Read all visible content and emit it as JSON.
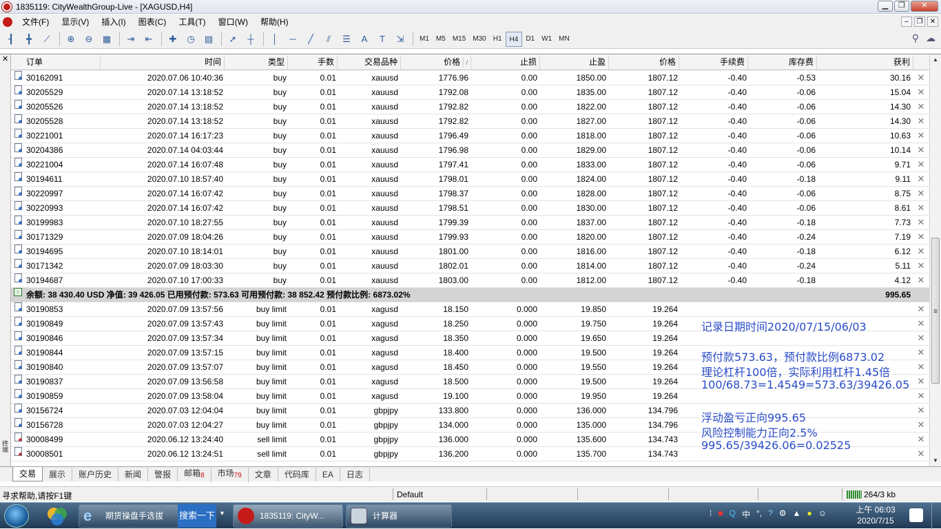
{
  "window": {
    "title": "1835119: CityWealthGroup-Live - [XAGUSD,H4]"
  },
  "menu": [
    "文件(F)",
    "显示(V)",
    "插入(I)",
    "图表(C)",
    "工具(T)",
    "窗口(W)",
    "帮助(H)"
  ],
  "toolbar": {
    "timeframes": [
      "M1",
      "M5",
      "M15",
      "M30",
      "H1",
      "H4",
      "D1",
      "W1",
      "MN"
    ],
    "active_timeframe": "H4"
  },
  "table": {
    "columns": {
      "order": "订单",
      "time": "时间",
      "type": "类型",
      "lots": "手数",
      "symbol": "交易品种",
      "price": "价格",
      "sl": "止损",
      "tp": "止盈",
      "current": "价格",
      "commission": "手续费",
      "swap": "库存费",
      "profit": "获利"
    },
    "positions": [
      {
        "order": "30162091",
        "time": "2020.07.06 10:40:36",
        "type": "buy",
        "lots": "0.01",
        "symbol": "xauusd",
        "price": "1776.96",
        "sl": "0.00",
        "tp": "1850.00",
        "current": "1807.12",
        "commission": "-0.40",
        "swap": "-0.53",
        "profit": "30.16"
      },
      {
        "order": "30205529",
        "time": "2020.07.14 13:18:52",
        "type": "buy",
        "lots": "0.01",
        "symbol": "xauusd",
        "price": "1792.08",
        "sl": "0.00",
        "tp": "1835.00",
        "current": "1807.12",
        "commission": "-0.40",
        "swap": "-0.06",
        "profit": "15.04"
      },
      {
        "order": "30205526",
        "time": "2020.07.14 13:18:52",
        "type": "buy",
        "lots": "0.01",
        "symbol": "xauusd",
        "price": "1792.82",
        "sl": "0.00",
        "tp": "1822.00",
        "current": "1807.12",
        "commission": "-0.40",
        "swap": "-0.06",
        "profit": "14.30"
      },
      {
        "order": "30205528",
        "time": "2020.07.14 13:18:52",
        "type": "buy",
        "lots": "0.01",
        "symbol": "xauusd",
        "price": "1792.82",
        "sl": "0.00",
        "tp": "1827.00",
        "current": "1807.12",
        "commission": "-0.40",
        "swap": "-0.06",
        "profit": "14.30"
      },
      {
        "order": "30221001",
        "time": "2020.07.14 16:17:23",
        "type": "buy",
        "lots": "0.01",
        "symbol": "xauusd",
        "price": "1796.49",
        "sl": "0.00",
        "tp": "1818.00",
        "current": "1807.12",
        "commission": "-0.40",
        "swap": "-0.06",
        "profit": "10.63"
      },
      {
        "order": "30204386",
        "time": "2020.07.14 04:03:44",
        "type": "buy",
        "lots": "0.01",
        "symbol": "xauusd",
        "price": "1796.98",
        "sl": "0.00",
        "tp": "1829.00",
        "current": "1807.12",
        "commission": "-0.40",
        "swap": "-0.06",
        "profit": "10.14"
      },
      {
        "order": "30221004",
        "time": "2020.07.14 16:07:48",
        "type": "buy",
        "lots": "0.01",
        "symbol": "xauusd",
        "price": "1797.41",
        "sl": "0.00",
        "tp": "1833.00",
        "current": "1807.12",
        "commission": "-0.40",
        "swap": "-0.06",
        "profit": "9.71"
      },
      {
        "order": "30194611",
        "time": "2020.07.10 18:57:40",
        "type": "buy",
        "lots": "0.01",
        "symbol": "xauusd",
        "price": "1798.01",
        "sl": "0.00",
        "tp": "1824.00",
        "current": "1807.12",
        "commission": "-0.40",
        "swap": "-0.18",
        "profit": "9.11"
      },
      {
        "order": "30220997",
        "time": "2020.07.14 16:07:42",
        "type": "buy",
        "lots": "0.01",
        "symbol": "xauusd",
        "price": "1798.37",
        "sl": "0.00",
        "tp": "1828.00",
        "current": "1807.12",
        "commission": "-0.40",
        "swap": "-0.06",
        "profit": "8.75"
      },
      {
        "order": "30220993",
        "time": "2020.07.14 16:07:42",
        "type": "buy",
        "lots": "0.01",
        "symbol": "xauusd",
        "price": "1798.51",
        "sl": "0.00",
        "tp": "1830.00",
        "current": "1807.12",
        "commission": "-0.40",
        "swap": "-0.06",
        "profit": "8.61"
      },
      {
        "order": "30199983",
        "time": "2020.07.10 18:27:55",
        "type": "buy",
        "lots": "0.01",
        "symbol": "xauusd",
        "price": "1799.39",
        "sl": "0.00",
        "tp": "1837.00",
        "current": "1807.12",
        "commission": "-0.40",
        "swap": "-0.18",
        "profit": "7.73"
      },
      {
        "order": "30171329",
        "time": "2020.07.09 18:04:26",
        "type": "buy",
        "lots": "0.01",
        "symbol": "xauusd",
        "price": "1799.93",
        "sl": "0.00",
        "tp": "1820.00",
        "current": "1807.12",
        "commission": "-0.40",
        "swap": "-0.24",
        "profit": "7.19"
      },
      {
        "order": "30194695",
        "time": "2020.07.10 18:14:01",
        "type": "buy",
        "lots": "0.01",
        "symbol": "xauusd",
        "price": "1801.00",
        "sl": "0.00",
        "tp": "1816.00",
        "current": "1807.12",
        "commission": "-0.40",
        "swap": "-0.18",
        "profit": "6.12"
      },
      {
        "order": "30171342",
        "time": "2020.07.09 18:03:30",
        "type": "buy",
        "lots": "0.01",
        "symbol": "xauusd",
        "price": "1802.01",
        "sl": "0.00",
        "tp": "1814.00",
        "current": "1807.12",
        "commission": "-0.40",
        "swap": "-0.24",
        "profit": "5.11"
      },
      {
        "order": "30194687",
        "time": "2020.07.10 17:00:33",
        "type": "buy",
        "lots": "0.01",
        "symbol": "xauusd",
        "price": "1803.00",
        "sl": "0.00",
        "tp": "1812.00",
        "current": "1807.12",
        "commission": "-0.40",
        "swap": "-0.18",
        "profit": "4.12"
      }
    ],
    "summary": {
      "text": "余额: 38 430.40 USD  净值: 39 426.05  已用预付款: 573.63  可用预付款: 38 852.42  预付款比例: 6873.02%",
      "profit": "995.65"
    },
    "pending": [
      {
        "order": "30190853",
        "time": "2020.07.09 13:57:56",
        "type": "buy limit",
        "lots": "0.01",
        "symbol": "xagusd",
        "price": "18.150",
        "sl": "0.000",
        "tp": "19.850",
        "current": "19.264"
      },
      {
        "order": "30190849",
        "time": "2020.07.09 13:57:43",
        "type": "buy limit",
        "lots": "0.01",
        "symbol": "xagusd",
        "price": "18.250",
        "sl": "0.000",
        "tp": "19.750",
        "current": "19.264"
      },
      {
        "order": "30190846",
        "time": "2020.07.09 13:57:34",
        "type": "buy limit",
        "lots": "0.01",
        "symbol": "xagusd",
        "price": "18.350",
        "sl": "0.000",
        "tp": "19.650",
        "current": "19.264"
      },
      {
        "order": "30190844",
        "time": "2020.07.09 13:57:15",
        "type": "buy limit",
        "lots": "0.01",
        "symbol": "xagusd",
        "price": "18.400",
        "sl": "0.000",
        "tp": "19.500",
        "current": "19.264"
      },
      {
        "order": "30190840",
        "time": "2020.07.09 13:57:07",
        "type": "buy limit",
        "lots": "0.01",
        "symbol": "xagusd",
        "price": "18.450",
        "sl": "0.000",
        "tp": "19.550",
        "current": "19.264"
      },
      {
        "order": "30190837",
        "time": "2020.07.09 13:56:58",
        "type": "buy limit",
        "lots": "0.01",
        "symbol": "xagusd",
        "price": "18.500",
        "sl": "0.000",
        "tp": "19.500",
        "current": "19.264"
      },
      {
        "order": "30190859",
        "time": "2020.07.09 13:58:04",
        "type": "buy limit",
        "lots": "0.01",
        "symbol": "xagusd",
        "price": "19.100",
        "sl": "0.000",
        "tp": "19.950",
        "current": "19.264"
      },
      {
        "order": "30156724",
        "time": "2020.07.03 12:04:04",
        "type": "buy limit",
        "lots": "0.01",
        "symbol": "gbpjpy",
        "price": "133.800",
        "sl": "0.000",
        "tp": "136.000",
        "current": "134.796"
      },
      {
        "order": "30156728",
        "time": "2020.07.03 12:04:27",
        "type": "buy limit",
        "lots": "0.01",
        "symbol": "gbpjpy",
        "price": "134.000",
        "sl": "0.000",
        "tp": "135.000",
        "current": "134.796"
      },
      {
        "order": "30008499",
        "time": "2020.06.12 13:24:40",
        "type": "sell limit",
        "lots": "0.01",
        "symbol": "gbpjpy",
        "price": "136.000",
        "sl": "0.000",
        "tp": "135.600",
        "current": "134.743"
      },
      {
        "order": "30008501",
        "time": "2020.06.12 13:24:51",
        "type": "sell limit",
        "lots": "0.01",
        "symbol": "gbpjpy",
        "price": "136.200",
        "sl": "0.000",
        "tp": "135.700",
        "current": "134.743"
      }
    ]
  },
  "annotations": [
    "记录日期时间2020/07/15/06/03",
    "预付款573.63，预付款比例6873.02",
    "理论杠杆100倍，实际利用杠杆1.45倍",
    "100/68.73=1.4549=573.63/39426.05",
    "浮动盈亏正向995.65",
    "风险控制能力正向2.5%",
    "995.65/39426.06=0.02525"
  ],
  "sidebar_label": "终端",
  "tabs": [
    {
      "label": "交易",
      "badge": ""
    },
    {
      "label": "展示",
      "badge": ""
    },
    {
      "label": "账户历史",
      "badge": ""
    },
    {
      "label": "新闻",
      "badge": ""
    },
    {
      "label": "警报",
      "badge": ""
    },
    {
      "label": "邮箱",
      "badge": "8"
    },
    {
      "label": "市场",
      "badge": "79"
    },
    {
      "label": "文章",
      "badge": ""
    },
    {
      "label": "代码库",
      "badge": ""
    },
    {
      "label": "EA",
      "badge": ""
    },
    {
      "label": "日志",
      "badge": ""
    }
  ],
  "active_tab": "交易",
  "status": {
    "help": "寻求帮助,请按F1键",
    "profile": "Default",
    "traffic": "264/3 kb"
  },
  "taskbar": {
    "items": [
      "期货操盘手选拔",
      "1835119: CityW...",
      "计算器"
    ],
    "search_label": "搜索一下",
    "tray_lang": "中",
    "time": "上午 06:03",
    "date": "2020/7/15"
  }
}
